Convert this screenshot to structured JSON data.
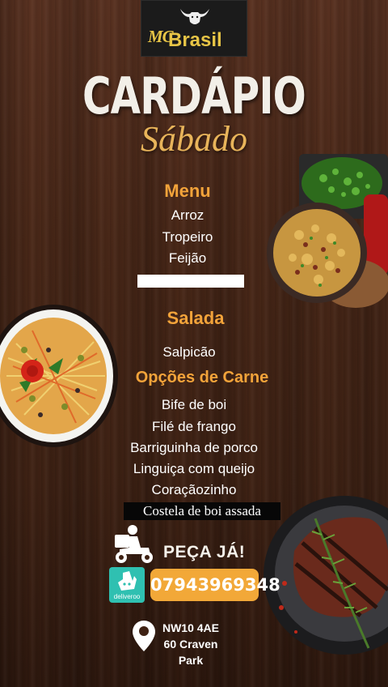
{
  "logo": {
    "mc": "MC",
    "name": "Brasil",
    "icon": "bull-icon"
  },
  "title": "CARDÁPIO",
  "subtitle": "Sábado",
  "menu": {
    "heading": "Menu",
    "items": [
      "Arroz",
      "Tropeiro",
      "Feijão"
    ]
  },
  "salad": {
    "heading": "Salada",
    "items": [
      "Salpicão"
    ]
  },
  "meat": {
    "heading": "Opções de Carne",
    "items": [
      "Bife de boi",
      "Filé de frango",
      "Barriguinha de porco",
      "Linguiça com queijo",
      "Coraçãozinho"
    ],
    "highlight": "Costela de boi assada"
  },
  "order": {
    "cta": "PEÇA JÁ!",
    "phone": "07943969348",
    "deliveroo_label": "deliveroo",
    "icons": [
      "delivery-scooter-icon",
      "deliveroo-icon",
      "location-pin-icon"
    ]
  },
  "address": {
    "line1": "NW10 4AE",
    "line2": "60 Craven",
    "line3": "Park"
  },
  "colors": {
    "accent": "#f2a33a",
    "logo_gold": "#e8c546",
    "phone_bg": "#f2a838",
    "deliveroo": "#2fc0b1"
  }
}
